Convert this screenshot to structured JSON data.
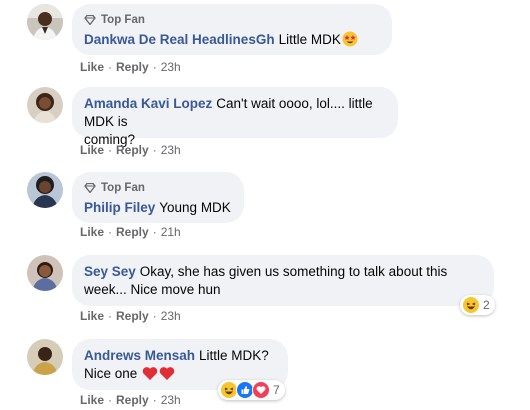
{
  "comments": [
    {
      "top_fan_label": "Top Fan",
      "author": "Dankwa De Real HeadlinesGh",
      "text": "Little MDK",
      "emoji": "star-struck-emoji",
      "actions": {
        "like": "Like",
        "reply": "Reply",
        "time": "23h"
      }
    },
    {
      "author": "Amanda Kavi Lopez",
      "text_line1": "Can't wait oooo, lol.... little MDK is",
      "text_line2": "coming?",
      "actions": {
        "like": "Like",
        "reply": "Reply",
        "time": "23h"
      }
    },
    {
      "top_fan_label": "Top Fan",
      "author": "Philip Filey",
      "text": "Young MDK",
      "actions": {
        "like": "Like",
        "reply": "Reply",
        "time": "21h"
      }
    },
    {
      "author": "Sey Sey",
      "text_line1": "Okay, she has given us something to talk about this",
      "text_line2": "week... Nice move hun",
      "reactions": {
        "icons": [
          "haha-icon"
        ],
        "count": "2"
      },
      "actions": {
        "like": "Like",
        "reply": "Reply",
        "time": "23h"
      }
    },
    {
      "author": "Andrews Mensah",
      "text_line1": "Little MDK?",
      "text_line2": "Nice one",
      "emojis": [
        "red-heart-emoji",
        "red-heart-emoji"
      ],
      "reactions": {
        "icons": [
          "haha-icon",
          "like-icon",
          "love-icon"
        ],
        "count": "7"
      },
      "actions": {
        "like": "Like",
        "reply": "Reply",
        "time": "23h"
      }
    }
  ],
  "colors": {
    "author": "#385898",
    "bubble": "#f0f2f5",
    "meta": "#65676b"
  }
}
